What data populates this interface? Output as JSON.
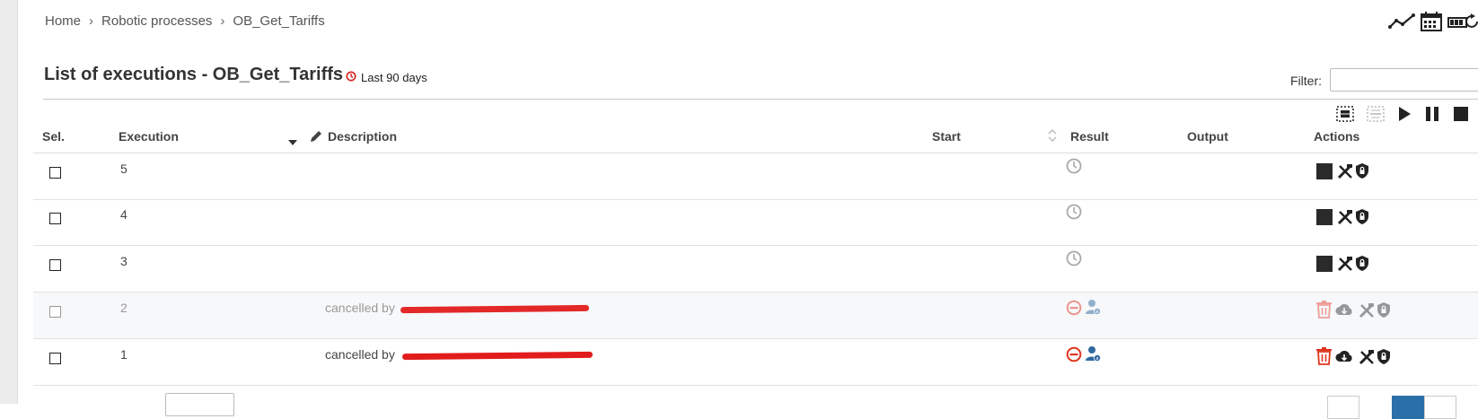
{
  "breadcrumb": {
    "items": [
      "Home",
      "Robotic processes",
      "OB_Get_Tariffs"
    ],
    "separator": "›"
  },
  "page": {
    "title": "List of executions - OB_Get_Tariffs",
    "period": "Last 90 days",
    "filter_label": "Filter:",
    "filter_value": ""
  },
  "table": {
    "headers": {
      "sel": "Sel.",
      "execution": "Execution",
      "description": "Description",
      "start": "Start",
      "result": "Result",
      "output": "Output",
      "actions": "Actions"
    },
    "rows": [
      {
        "execution": "5",
        "description": "",
        "status": "pending",
        "disabled": false
      },
      {
        "execution": "4",
        "description": "",
        "status": "pending",
        "disabled": false
      },
      {
        "execution": "3",
        "description": "",
        "status": "pending",
        "disabled": false
      },
      {
        "execution": "2",
        "description": "cancelled by",
        "status": "cancelled",
        "disabled": true
      },
      {
        "execution": "1",
        "description": "cancelled by",
        "status": "cancelled",
        "disabled": false
      }
    ]
  },
  "colors": {
    "cancel_red": "#e0341f",
    "user_blue": "#2f6aa0",
    "pending_gray": "#a9a9a9",
    "pager_active": "#2a6fa8",
    "redaction": "#e21c1c"
  },
  "icons": {
    "top": [
      "line-chart-icon",
      "calendar-icon",
      "battery-refresh-icon"
    ],
    "toolbar": [
      "select-all-icon",
      "deselect-all-icon",
      "play-icon",
      "pause-icon",
      "stop-icon"
    ],
    "pending_actions": [
      "stop-icon",
      "tools-icon",
      "shield-lock-icon"
    ],
    "cancelled_actions": [
      "trash-icon",
      "cloud-download-icon",
      "tools-icon",
      "shield-lock-icon"
    ],
    "cancelled_result": [
      "cancel-circle-icon",
      "user-info-icon"
    ],
    "pending_result": [
      "clock-icon"
    ]
  }
}
